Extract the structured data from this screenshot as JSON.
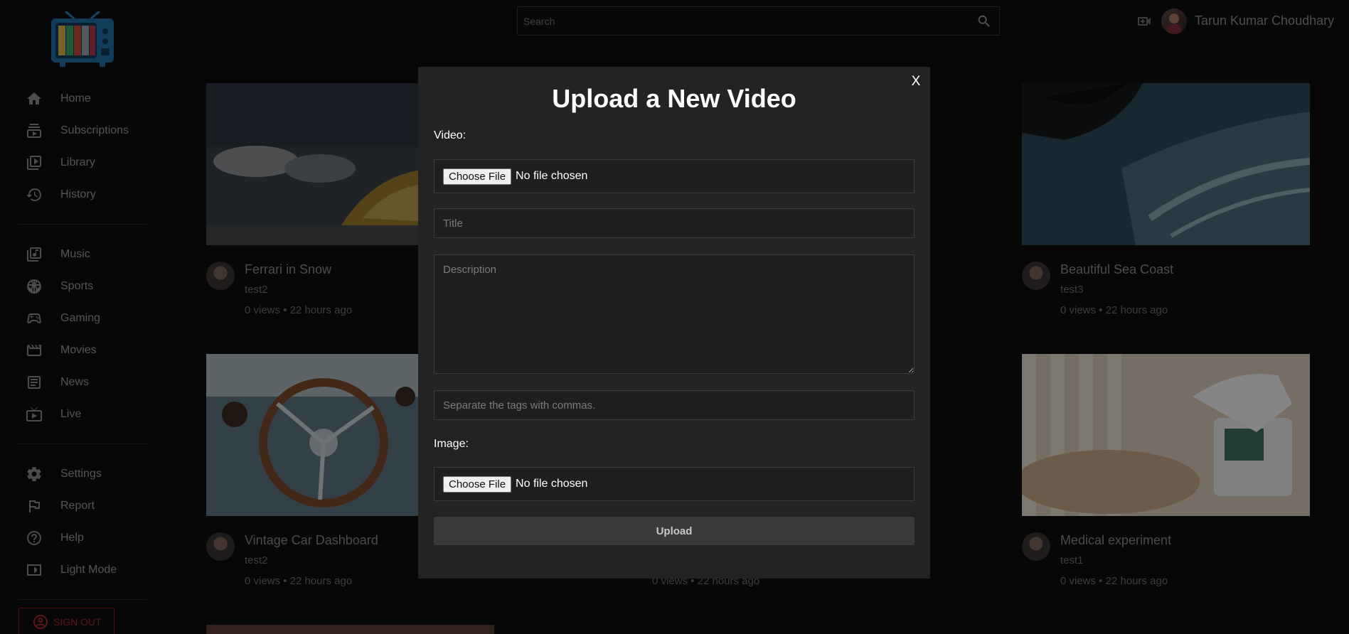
{
  "topbar": {
    "search_placeholder": "Search",
    "username": "Tarun Kumar Choudhary"
  },
  "sidebar": {
    "groups": [
      [
        {
          "label": "Home",
          "icon": "home-icon"
        },
        {
          "label": "Subscriptions",
          "icon": "subscriptions-icon"
        },
        {
          "label": "Library",
          "icon": "library-icon"
        },
        {
          "label": "History",
          "icon": "history-icon"
        }
      ],
      [
        {
          "label": "Music",
          "icon": "music-icon"
        },
        {
          "label": "Sports",
          "icon": "sports-icon"
        },
        {
          "label": "Gaming",
          "icon": "gaming-icon"
        },
        {
          "label": "Movies",
          "icon": "movies-icon"
        },
        {
          "label": "News",
          "icon": "news-icon"
        },
        {
          "label": "Live",
          "icon": "live-icon"
        }
      ],
      [
        {
          "label": "Settings",
          "icon": "settings-icon"
        },
        {
          "label": "Report",
          "icon": "report-icon"
        },
        {
          "label": "Help",
          "icon": "help-icon"
        },
        {
          "label": "Light Mode",
          "icon": "light-mode-icon"
        }
      ]
    ],
    "signout_label": "SIGN OUT"
  },
  "videos": [
    {
      "title": "Ferrari in Snow",
      "channel": "test2",
      "views": "0 views • 22 hours ago"
    },
    {
      "title": "Beautiful Sea Coast",
      "channel": "test3",
      "views": "0 views • 22 hours ago"
    },
    {
      "title": "Vintage Car Dashboard",
      "channel": "test2",
      "views": "0 views • 22 hours ago"
    },
    {
      "title": "",
      "channel": "",
      "views": "0 views • 22 hours ago"
    },
    {
      "title": "Medical experiment",
      "channel": "test1",
      "views": "0 views • 22 hours ago"
    }
  ],
  "modal": {
    "close_label": "X",
    "title": "Upload a New Video",
    "video_label": "Video:",
    "choose_file_label": "Choose File",
    "no_file_text": "No file chosen",
    "title_placeholder": "Title",
    "description_placeholder": "Description",
    "tags_placeholder": "Separate the tags with commas.",
    "image_label": "Image:",
    "upload_label": "Upload"
  },
  "colors": {
    "background": "#0d0d0d",
    "modal_bg": "#232323",
    "signout_red": "#a52a2a"
  }
}
